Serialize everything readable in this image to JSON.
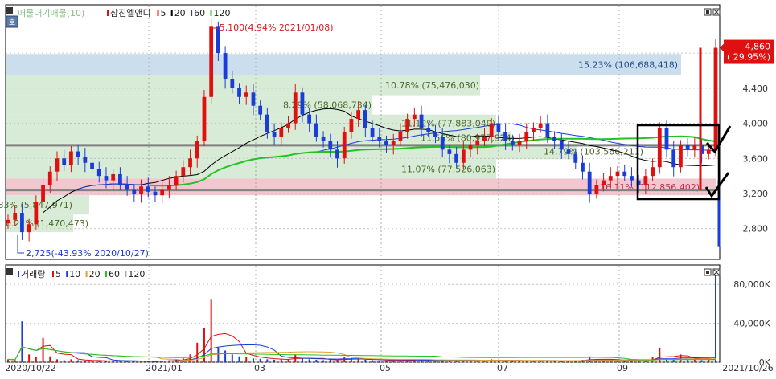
{
  "chart_data": [
    {
      "type": "candlestick",
      "legend": [
        {
          "label": "매물대기매물(10)",
          "color": "#7fbf7f"
        },
        {
          "label": "삼진엘앤디",
          "color": "#e01010"
        },
        {
          "label": "5",
          "color": "#e01010"
        },
        {
          "label": "20",
          "color": "#000000"
        },
        {
          "label": "60",
          "color": "#1a3cd8"
        },
        {
          "label": "120",
          "color": "#22c322"
        }
      ],
      "ylim": [
        2450,
        5350
      ],
      "y_ticks": [
        "4,800",
        "4,400",
        "4,000",
        "3,600",
        "3,200",
        "2,800"
      ],
      "y_tick_values": [
        4800,
        4400,
        4000,
        3600,
        3200,
        2800
      ],
      "x_labels": [
        "2020/10/22",
        "2021/01",
        "03",
        "05",
        "07",
        "09",
        "2021/10/26"
      ],
      "x_label_frac": [
        0.0,
        0.21,
        0.36,
        0.54,
        0.7,
        0.87,
        1.0
      ],
      "price_bands": [
        {
          "label": "15.23% (106,688,418)",
          "y_low": 4550,
          "y_high": 4790,
          "color": "#c7dced"
        },
        {
          "label": "10.78% (75,476,030)",
          "y_low": 4320,
          "y_high": 4550,
          "color": "#d6ead4"
        },
        {
          "label": "8.29% (58,068,734)",
          "y_low": 4100,
          "y_high": 4320,
          "color": "#d6ead4"
        },
        {
          "label": "11.12% (77,883,040)",
          "y_low": 3900,
          "y_high": 4100,
          "color": "#d6ead4"
        },
        {
          "label": "11.56% (80,977,924)",
          "y_low": 3770,
          "y_high": 3900,
          "color": "#d6ead4"
        },
        {
          "label": "14.79% (103,566,211)",
          "y_low": 3590,
          "y_high": 3770,
          "color": "#d6ead4"
        },
        {
          "label": "11.07% (77,526,063)",
          "y_low": 3370,
          "y_high": 3590,
          "color": "#d6ead4"
        },
        {
          "label": "16.11% (112,856,402)",
          "y_low": 3180,
          "y_high": 3370,
          "color": "#f2c4cc"
        },
        {
          "label": "0.83% (5,847,971)",
          "y_low": 2960,
          "y_high": 3180,
          "color": "#d6ead4"
        },
        {
          "label": "0.21% (1,470,473)",
          "y_low": 2760,
          "y_high": 2960,
          "color": "#d6ead4"
        }
      ],
      "annotations": {
        "high": "5,100(4.94% 2021/01/08)",
        "low": "2,725(-43.93% 2020/10/27)",
        "last_price": "4,860",
        "last_change": "( 29.95%)"
      },
      "reference_lines": [
        3750,
        3240
      ],
      "price_series": [
        2900,
        2980,
        2760,
        2850,
        3100,
        3300,
        3450,
        3600,
        3520,
        3680,
        3620,
        3550,
        3480,
        3400,
        3350,
        3420,
        3300,
        3250,
        3200,
        3280,
        3220,
        3180,
        3250,
        3300,
        3400,
        3500,
        3600,
        3800,
        4300,
        5100,
        4800,
        4500,
        4400,
        4300,
        4350,
        4200,
        4100,
        3900,
        3850,
        3950,
        4000,
        4350,
        4100,
        4000,
        3850,
        3800,
        3700,
        3600,
        3900,
        4050,
        4150,
        3950,
        3850,
        3800,
        3750,
        3800,
        3900,
        4050,
        4100,
        3950,
        3900,
        3850,
        3700,
        3650,
        3550,
        3700,
        3750,
        3800,
        3850,
        4000,
        3900,
        3800,
        3750,
        3800,
        3900,
        3950,
        4000,
        3850,
        3800,
        3700,
        3650,
        3550,
        3450,
        3200,
        3300,
        3350,
        3400,
        3450,
        3400,
        3350,
        3300,
        3400,
        3500,
        3950,
        3700,
        3500,
        3750,
        3700,
        3750,
        3650,
        3700,
        4860
      ]
    },
    {
      "type": "bar",
      "legend": [
        {
          "label": "거래량",
          "color": "#1a3cd8"
        },
        {
          "label": "5",
          "color": "#e01010"
        },
        {
          "label": "10",
          "color": "#1a3cd8"
        },
        {
          "label": "20",
          "color": "#e0a030"
        },
        {
          "label": "60",
          "color": "#22c322"
        },
        {
          "label": "120",
          "color": "#aaaaaa"
        }
      ],
      "ylim": [
        0,
        100000
      ],
      "y_ticks": [
        "80,000K",
        "40,000K",
        "0K"
      ],
      "y_tick_values": [
        80000,
        40000,
        0
      ],
      "volume_series": [
        3000,
        2000,
        42000,
        8000,
        5000,
        25000,
        6000,
        3000,
        2000,
        3000,
        2000,
        1500,
        1200,
        1000,
        1500,
        1200,
        1000,
        900,
        1100,
        900,
        1000,
        1200,
        1500,
        2000,
        3000,
        4000,
        8000,
        20000,
        35000,
        65000,
        15000,
        12000,
        8000,
        6000,
        5000,
        4000,
        3500,
        3000,
        2500,
        3000,
        2500,
        8000,
        4000,
        3000,
        2500,
        2000,
        2500,
        2000,
        5000,
        4000,
        3000,
        2500,
        2000,
        1800,
        1600,
        1500,
        2000,
        3000,
        2500,
        2000,
        1800,
        1500,
        1400,
        1300,
        2000,
        1800,
        1500,
        1400,
        1500,
        3000,
        2000,
        1500,
        1400,
        1300,
        1500,
        1800,
        2000,
        1500,
        1300,
        1200,
        1500,
        1800,
        2500,
        6000,
        2500,
        2000,
        1800,
        1500,
        1400,
        1200,
        1500,
        2500,
        5000,
        15000,
        4000,
        2500,
        8000,
        3000,
        2500,
        2000,
        3000,
        93000
      ]
    }
  ],
  "ui": {
    "overlay_icon_label": "호"
  }
}
